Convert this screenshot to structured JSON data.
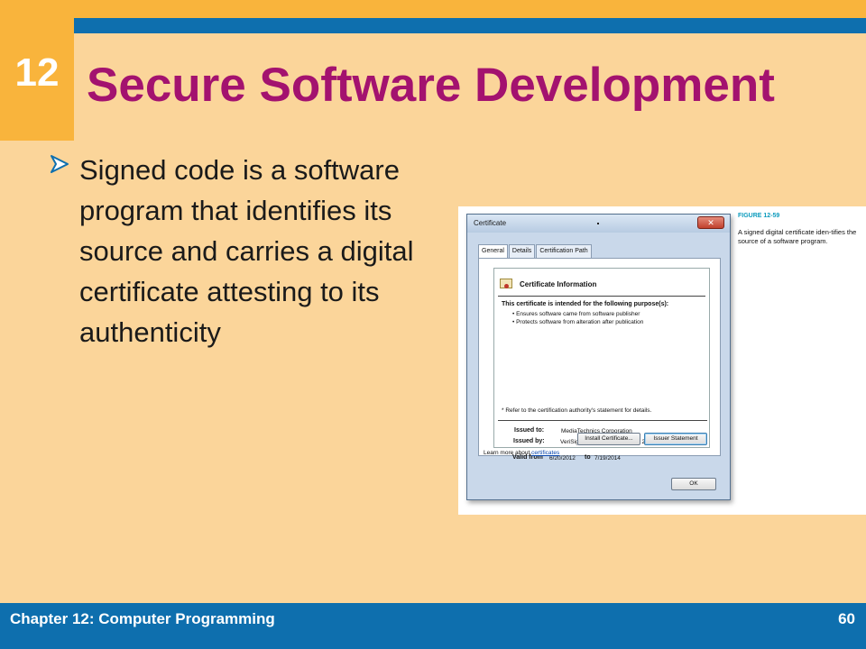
{
  "slide": {
    "chapter_number": "12",
    "title": "Secure Software Development",
    "bullet": "Signed code is a software program that identifies its source and carries a digital certificate attesting to its authenticity"
  },
  "figure": {
    "window_title": "Certificate",
    "close_glyph": "✕",
    "tabs": [
      "General",
      "Details",
      "Certification Path"
    ],
    "info_title": "Certificate Information",
    "purpose_heading": "This certificate is intended for the following purpose(s):",
    "purposes": [
      "• Ensures software came from software publisher",
      "• Protects software from alteration after publication"
    ],
    "refer_note": "* Refer to the certification authority's statement for details.",
    "issued_to_label": "Issued to:",
    "issued_to_value": "MediaTechnics Corporation",
    "issued_by_label": "Issued by:",
    "issued_by_value": "VeriSign Class 3 Code Signing 2001 CA",
    "valid_from_label": "Valid from",
    "valid_from_value": "6/20/2012",
    "valid_to_label": "to",
    "valid_to_value": "7/19/2014",
    "install_button": "Install Certificate...",
    "issuer_button": "Issuer Statement",
    "learn_more_prefix": "Learn more about",
    "learn_more_link": "certificates",
    "ok_button": "OK",
    "caption_label": "FIGURE 12-59",
    "caption_text": "A signed digital certificate iden-tifies the source of a software program."
  },
  "footer": {
    "chapter": "Chapter 12: Computer Programming",
    "page": "60"
  },
  "colors": {
    "background": "#fbd59a",
    "accent_orange": "#f9b43c",
    "accent_blue": "#0e6fae",
    "title": "#a3126f",
    "caption_label": "#0c9bbd"
  }
}
